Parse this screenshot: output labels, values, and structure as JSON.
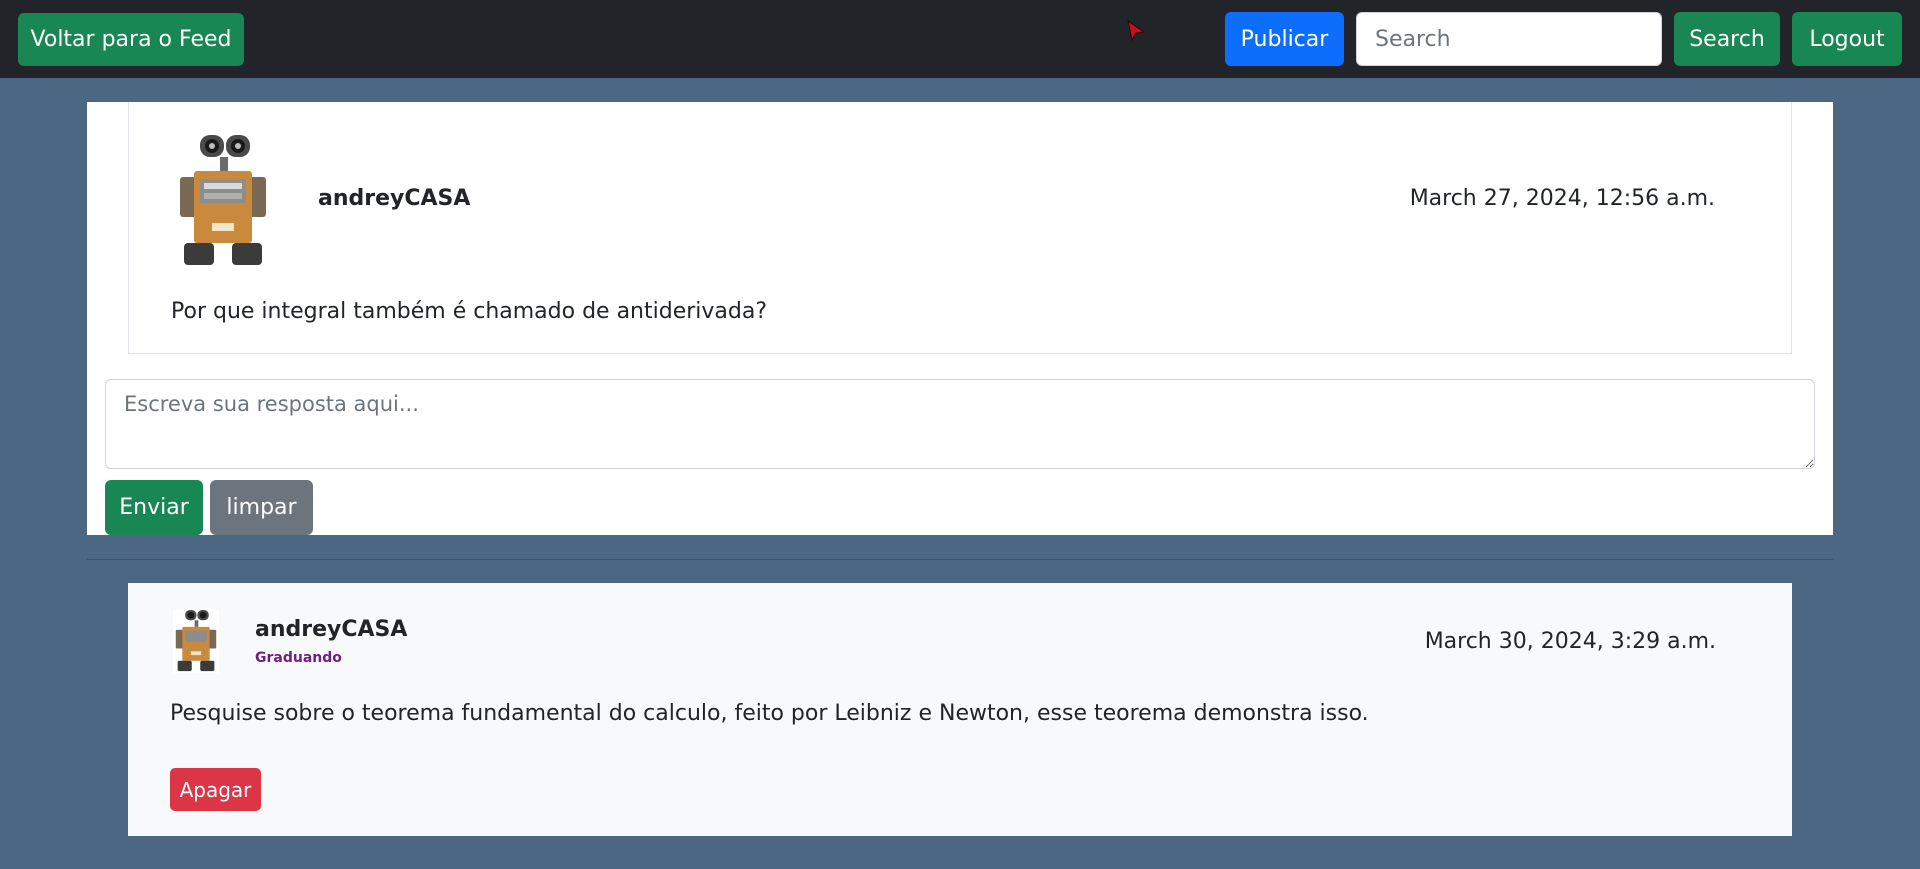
{
  "navbar": {
    "back_label": "Voltar para o Feed",
    "publish_label": "Publicar",
    "search_placeholder": "Search",
    "search_value": "",
    "search_label": "Search",
    "logout_label": "Logout"
  },
  "question": {
    "author": "andreyCASA",
    "timestamp": "March 27, 2024, 12:56 a.m.",
    "text": "Por que integral também é chamado de antiderivada?"
  },
  "reply_form": {
    "placeholder": "Escreva sua resposta aqui...",
    "value": "",
    "submit_label": "Enviar",
    "clear_label": "limpar"
  },
  "answers": [
    {
      "author": "andreyCASA",
      "role": "Graduando",
      "timestamp": "March 30, 2024, 3:29 a.m.",
      "text": "Pesquise sobre o teorema fundamental do calculo, feito por Leibniz e Newton, esse teorema demonstra isso.",
      "delete_label": "Apagar"
    }
  ],
  "colors": {
    "page_background": "#4c6783",
    "navbar": "#212529",
    "success": "#198754",
    "primary": "#0d6efd",
    "secondary": "#6c757d",
    "danger": "#dc3545",
    "role_badge": "#6f1f7f"
  }
}
